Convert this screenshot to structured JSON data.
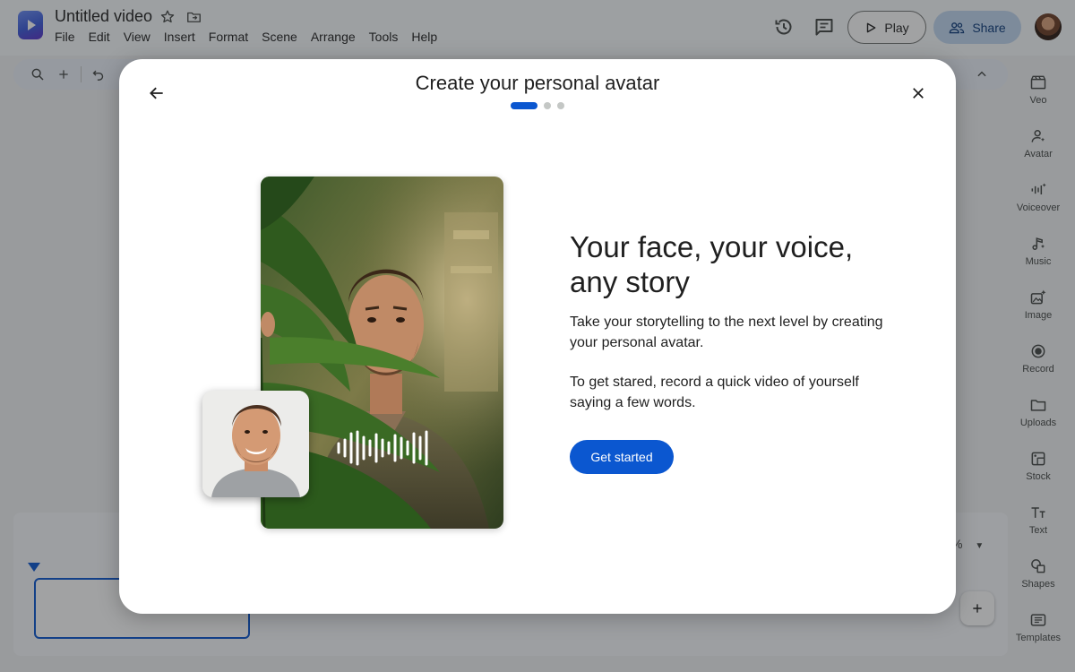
{
  "app": {
    "doc_title": "Untitled video",
    "menu": [
      "File",
      "Edit",
      "View",
      "Insert",
      "Format",
      "Scene",
      "Arrange",
      "Tools",
      "Help"
    ],
    "play_label": "Play",
    "share_label": "Share"
  },
  "side_panel": {
    "items": [
      {
        "label": "Veo",
        "icon": "clapper-icon"
      },
      {
        "label": "Avatar",
        "icon": "avatar-icon"
      },
      {
        "label": "Voiceover",
        "icon": "voiceover-icon"
      },
      {
        "label": "Music",
        "icon": "music-icon"
      },
      {
        "label": "Image",
        "icon": "image-sparkle-icon"
      },
      {
        "label": "Record",
        "icon": "record-icon"
      },
      {
        "label": "Uploads",
        "icon": "folder-icon"
      },
      {
        "label": "Stock",
        "icon": "stock-icon"
      },
      {
        "label": "Text",
        "icon": "text-icon"
      },
      {
        "label": "Shapes",
        "icon": "shapes-icon"
      },
      {
        "label": "Templates",
        "icon": "templates-icon"
      }
    ]
  },
  "timeline": {
    "zoom_suffix": "%"
  },
  "modal": {
    "title": "Create your personal avatar",
    "steps_total": 3,
    "active_step": 1,
    "headline": "Your face, your voice, any story",
    "paragraph1": "Take your storytelling to the next level by creating your personal avatar.",
    "paragraph2": "To get stared, record a quick video of yourself saying a few words.",
    "cta_label": "Get started"
  },
  "colors": {
    "accent": "#0b57d0",
    "share_bg": "#c2d8f2",
    "scrim": "rgba(32,33,36,0.42)"
  }
}
